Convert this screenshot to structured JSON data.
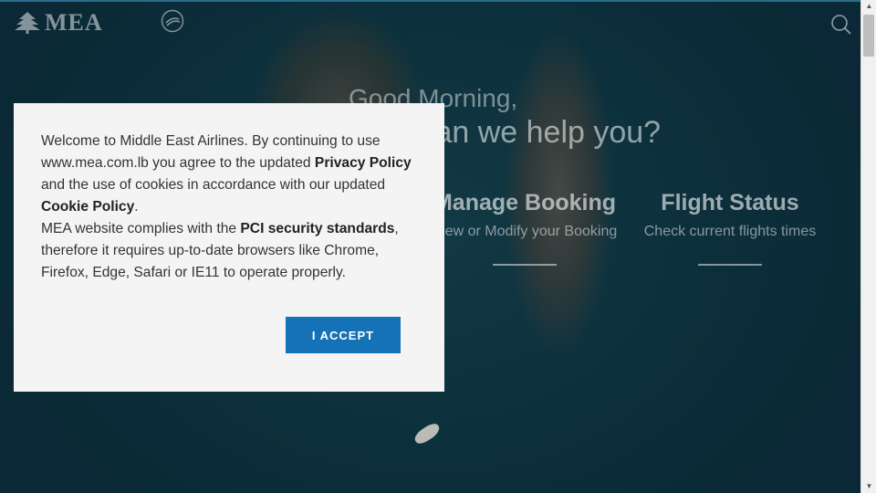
{
  "header": {
    "logo_text": "MEA",
    "logo_icon": "cedar-icon",
    "alliance_icon": "skyteam-icon",
    "search_icon": "search-icon"
  },
  "hero": {
    "greeting": "Good Morning,",
    "question": "How can we help you?"
  },
  "quick_links": [
    {
      "title": "Manage Booking",
      "subtitle": "View or Modify your Booking"
    },
    {
      "title": "Flight Status",
      "subtitle": "Check current flights times"
    }
  ],
  "cookie_banner": {
    "p1_a": "Welcome to Middle East Airlines. By continuing to use www.mea.com.lb you agree to the updated ",
    "p1_link1": "Privacy Policy",
    "p1_b": " and the use of cookies in accordance with our updated ",
    "p1_link2": "Cookie Policy",
    "p1_c": ".",
    "p2_a": "MEA website complies with the ",
    "p2_bold": "PCI security standards",
    "p2_b": ", therefore it requires up-to-date browsers like Chrome, Firefox, Edge, Safari or IE11 to operate properly.",
    "accept_label": "I ACCEPT"
  },
  "colors": {
    "accent": "#1572b6",
    "banner_bg": "#f4f4f4"
  }
}
